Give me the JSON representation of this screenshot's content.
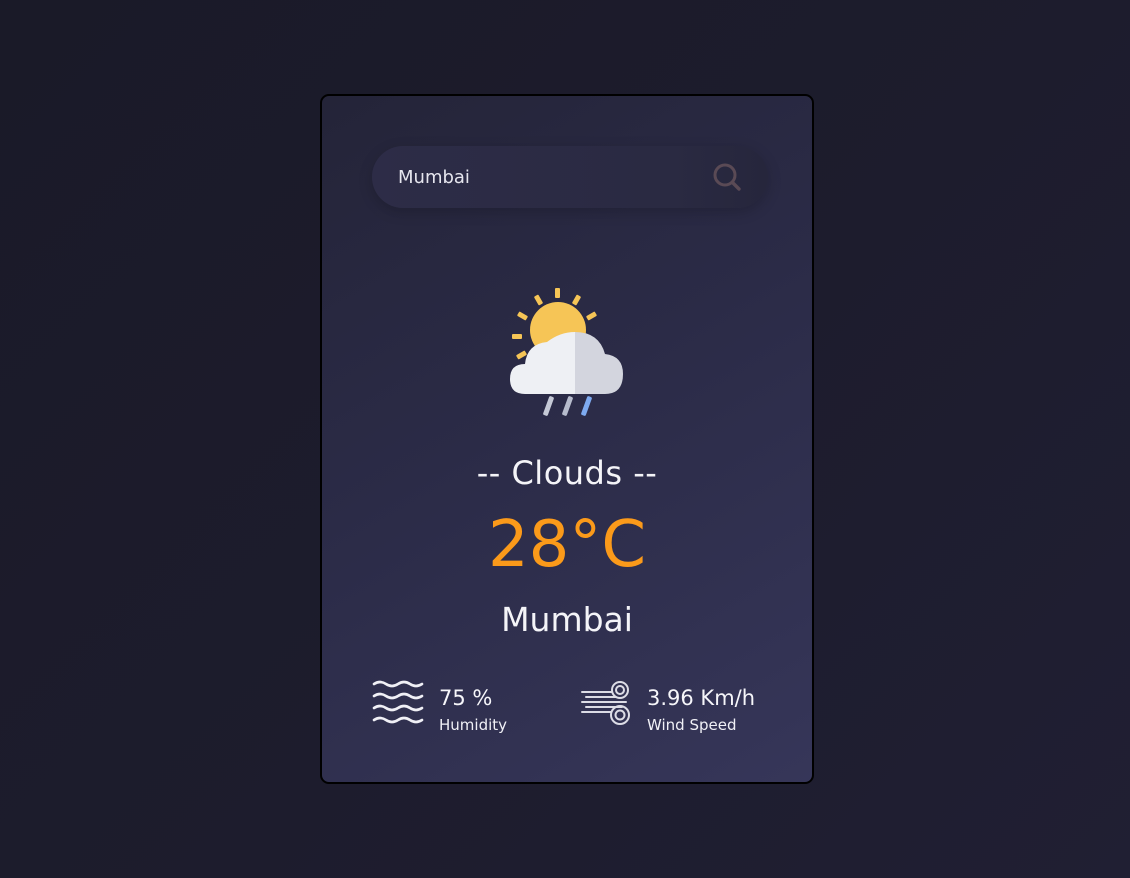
{
  "search": {
    "value": "Mumbai",
    "placeholder": ""
  },
  "weather": {
    "icon": "sun-cloud-rain-icon",
    "condition": "-- Clouds --",
    "temperature": "28°C",
    "city": "Mumbai"
  },
  "details": {
    "humidity": {
      "icon": "waves-icon",
      "value": "75 %",
      "label": "Humidity"
    },
    "wind": {
      "icon": "wind-icon",
      "value": "3.96 Km/h",
      "label": "Wind Speed"
    }
  },
  "colors": {
    "background": "#1c1b2b",
    "card": "#2b2b47",
    "accent_temperature": "#fb9a1a",
    "text": "#f4f4f8",
    "search_icon": "#5a4a55"
  }
}
